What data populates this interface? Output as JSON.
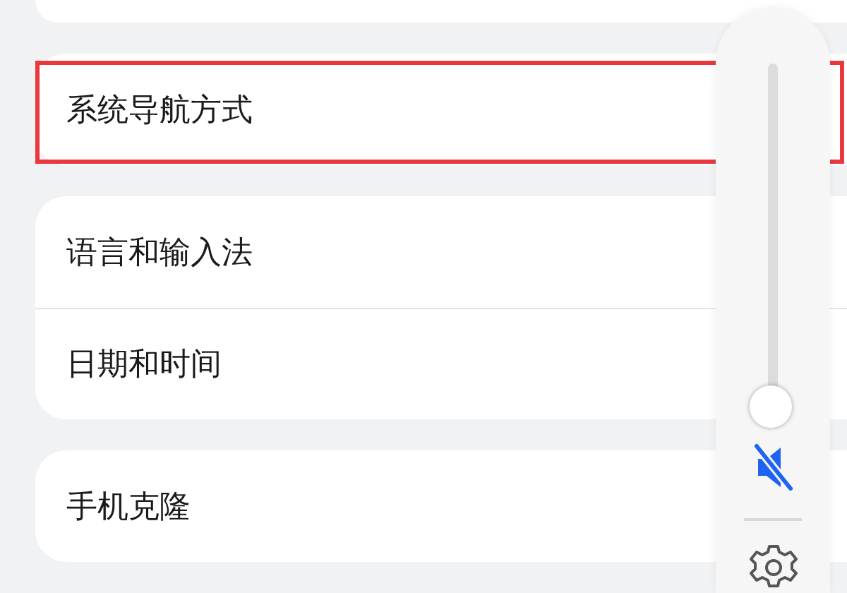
{
  "groups": [
    {
      "items": [
        {
          "label": "系统导航方式",
          "highlighted": true
        }
      ]
    },
    {
      "items": [
        {
          "label": "语言和输入法",
          "highlighted": false
        },
        {
          "label": "日期和时间",
          "highlighted": false
        }
      ]
    },
    {
      "items": [
        {
          "label": "手机克隆",
          "highlighted": false
        }
      ]
    }
  ],
  "volume": {
    "level": 0,
    "muted": true
  }
}
